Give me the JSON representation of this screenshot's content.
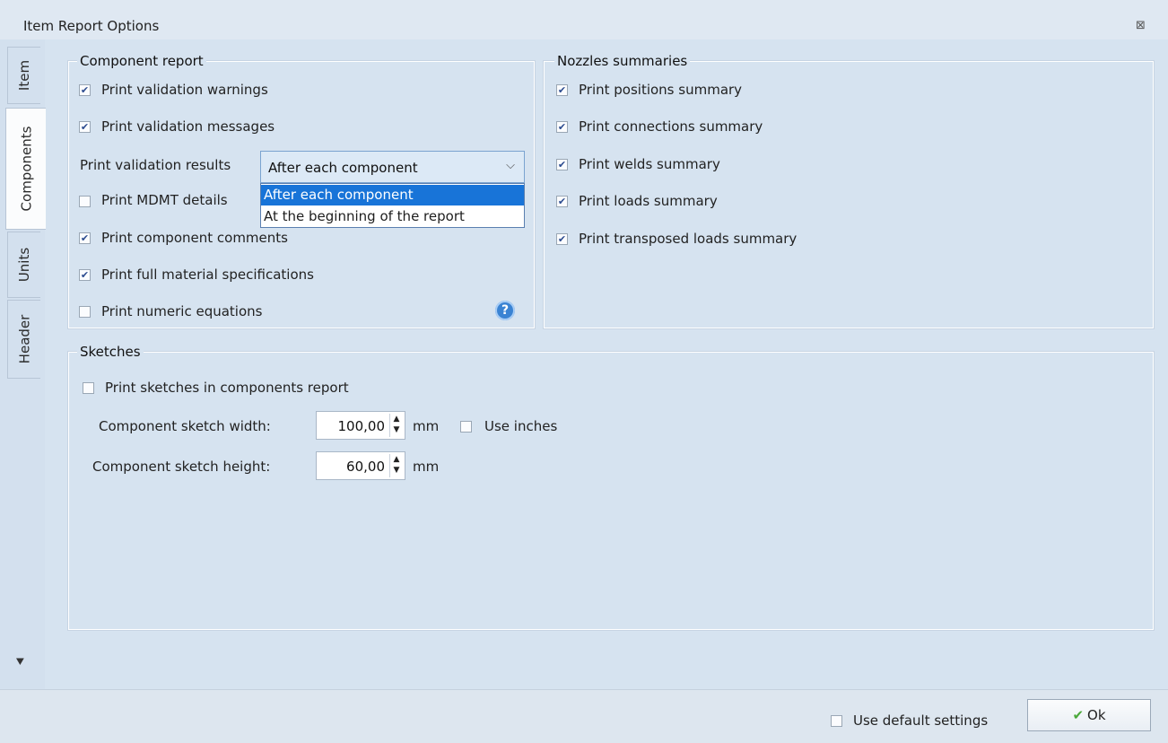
{
  "window": {
    "title": "Item Report Options"
  },
  "side_tabs": [
    {
      "label": "Item",
      "active": false
    },
    {
      "label": "Components",
      "active": true
    },
    {
      "label": "Units",
      "active": false
    },
    {
      "label": "Header",
      "active": false
    }
  ],
  "component_report": {
    "title": "Component report",
    "print_validation_warnings": {
      "label": "Print validation warnings",
      "checked": true
    },
    "print_validation_messages": {
      "label": "Print validation messages",
      "checked": true
    },
    "validation_results": {
      "label": "Print validation results",
      "selected": "After each component",
      "options": [
        "After each component",
        "At the beginning of the report"
      ]
    },
    "print_mdmt_details": {
      "label": "Print MDMT details",
      "checked": false
    },
    "print_component_comments": {
      "label": "Print component comments",
      "checked": true
    },
    "print_full_material_specs": {
      "label": "Print full material specifications",
      "checked": true
    },
    "print_numeric_equations": {
      "label": "Print numeric equations",
      "checked": false
    },
    "help_symbol": "?"
  },
  "nozzles_summaries": {
    "title": "Nozzles summaries",
    "items": [
      {
        "label": "Print positions summary",
        "checked": true
      },
      {
        "label": "Print connections summary",
        "checked": true
      },
      {
        "label": "Print welds summary",
        "checked": true
      },
      {
        "label": "Print loads summary",
        "checked": true
      },
      {
        "label": "Print transposed loads summary",
        "checked": true
      }
    ]
  },
  "sketches": {
    "title": "Sketches",
    "print_sketches": {
      "label": "Print sketches in components report",
      "checked": false
    },
    "width": {
      "label": "Component sketch width:",
      "value": "100,00",
      "unit": "mm"
    },
    "height": {
      "label": "Component sketch height:",
      "value": "60,00",
      "unit": "mm"
    },
    "use_inches": {
      "label": "Use inches",
      "checked": false
    }
  },
  "footer": {
    "use_default_settings": {
      "label": "Use default settings",
      "checked": false
    },
    "ok_label": "Ok"
  },
  "icons": {
    "close": "close-icon",
    "check": "checkmark-icon",
    "help": "help-icon",
    "scroll": "scroll-down-icon"
  }
}
